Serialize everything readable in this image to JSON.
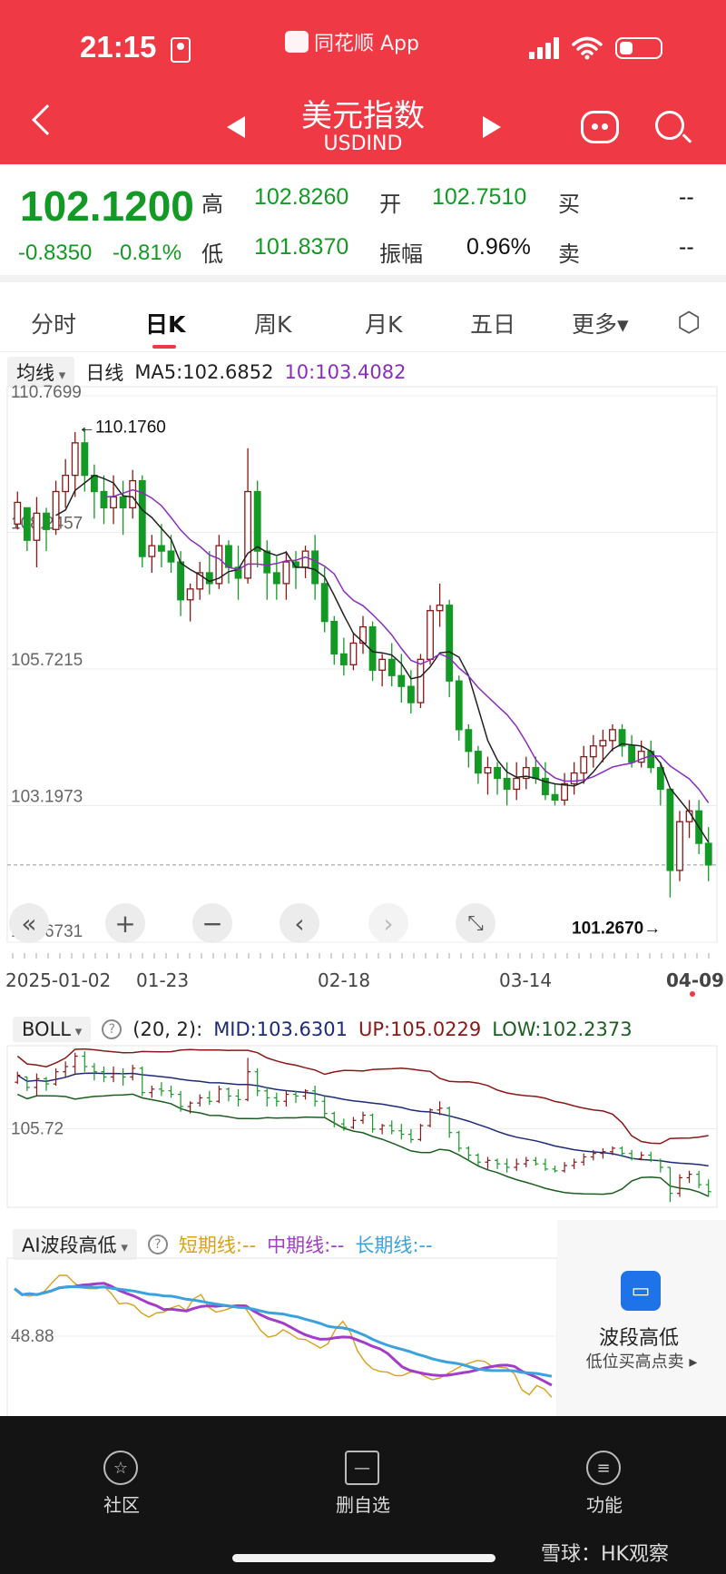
{
  "status_bar": {
    "time": "21:15",
    "app_label": "同花顺 App"
  },
  "header": {
    "title": "美元指数",
    "subtitle": "USDIND"
  },
  "quote": {
    "price": "102.1200",
    "change": "-0.8350",
    "change_pct": "-0.81%",
    "high_label": "高",
    "high": "102.8260",
    "open_label": "开",
    "open": "102.7510",
    "buy_label": "买",
    "buy": "--",
    "low_label": "低",
    "low": "101.8370",
    "amp_label": "振幅",
    "amp": "0.96%",
    "sell_label": "卖",
    "sell": "--"
  },
  "tabs": [
    "分时",
    "日K",
    "周K",
    "月K",
    "五日",
    "更多▾"
  ],
  "active_tab": 1,
  "ma_bar": {
    "selector": "均线",
    "period": "日线",
    "ma5": "MA5:102.6852",
    "ma10": "10:103.4082"
  },
  "main_chart": {
    "y_labels": [
      "110.7699",
      "108.2457",
      "105.7215",
      "103.1973",
      "100.6731"
    ],
    "y_values": [
      110.7699,
      108.2457,
      105.7215,
      103.1973,
      100.6731
    ],
    "max_annot": "←110.1760",
    "min_annot": "101.2670→",
    "x_labels": [
      "2025-01-02",
      "01-23",
      "02-18",
      "03-14",
      "04-09"
    ]
  },
  "controls": [
    "«",
    "+",
    "−",
    "‹",
    "›",
    "⤡"
  ],
  "boll": {
    "selector": "BOLL",
    "params": "(20, 2):",
    "mid": "MID:103.6301",
    "up": "UP:105.0229",
    "low": "LOW:102.2373",
    "y_label": "105.72"
  },
  "ai": {
    "selector": "AI波段高低",
    "short": "短期线:--",
    "mid": "中期线:--",
    "long": "长期线:--",
    "y_label": "48.88"
  },
  "wave_card": {
    "title": "波段高低",
    "subtitle": "低位买高点卖 ▸"
  },
  "colors": {
    "brand_red": "#ef3a45",
    "up": "#8b1717",
    "down": "#139a24",
    "ma10": "#8b2dbd"
  },
  "bottom_nav": [
    {
      "label": "社区",
      "icon": "star-icon"
    },
    {
      "label": "删自选",
      "icon": "minus-icon"
    },
    {
      "label": "功能",
      "icon": "menu-icon"
    }
  ],
  "watermark": "雪球：HK观察",
  "chart_data": {
    "type": "candlestick",
    "x_range": [
      "2025-01-02",
      "2025-04-09"
    ],
    "ylim": [
      100.6731,
      110.7699
    ],
    "series": [
      {
        "name": "日K",
        "values": [
          [
            108.4,
            109.0,
            108.3,
            108.8
          ],
          [
            108.7,
            108.7,
            107.9,
            108.1
          ],
          [
            108.1,
            108.9,
            107.6,
            108.6
          ],
          [
            108.6,
            108.7,
            107.9,
            108.3
          ],
          [
            108.3,
            109.2,
            108.2,
            109.0
          ],
          [
            109.0,
            109.6,
            108.7,
            109.3
          ],
          [
            109.3,
            110.1,
            108.9,
            109.9
          ],
          [
            109.9,
            110.18,
            109.0,
            109.3
          ],
          [
            109.3,
            109.5,
            108.5,
            109.0
          ],
          [
            109.0,
            109.3,
            108.4,
            108.7
          ],
          [
            108.7,
            109.3,
            108.4,
            108.9
          ],
          [
            108.9,
            109.2,
            108.2,
            108.7
          ],
          [
            108.7,
            109.4,
            108.5,
            109.2
          ],
          [
            109.2,
            109.3,
            107.6,
            107.8
          ],
          [
            107.8,
            108.2,
            107.5,
            108.0
          ],
          [
            108.0,
            108.4,
            107.6,
            107.9
          ],
          [
            107.9,
            108.2,
            107.5,
            107.7
          ],
          [
            107.7,
            107.9,
            106.7,
            107.0
          ],
          [
            107.0,
            107.3,
            106.6,
            107.2
          ],
          [
            107.2,
            107.7,
            107.0,
            107.5
          ],
          [
            107.5,
            107.9,
            107.1,
            107.3
          ],
          [
            107.3,
            108.2,
            107.2,
            108.0
          ],
          [
            108.0,
            108.1,
            107.3,
            107.6
          ],
          [
            107.6,
            108.0,
            107.0,
            107.4
          ],
          [
            107.4,
            109.8,
            107.3,
            109.0
          ],
          [
            109.0,
            109.2,
            107.6,
            107.9
          ],
          [
            107.9,
            108.1,
            107.0,
            107.5
          ],
          [
            107.5,
            107.8,
            107.0,
            107.3
          ],
          [
            107.3,
            107.9,
            107.0,
            107.7
          ],
          [
            107.7,
            107.9,
            107.2,
            107.6
          ],
          [
            107.6,
            108.0,
            107.4,
            107.9
          ],
          [
            107.9,
            108.2,
            107.0,
            107.3
          ],
          [
            107.3,
            107.6,
            106.4,
            106.6
          ],
          [
            106.6,
            106.7,
            105.8,
            106.0
          ],
          [
            106.0,
            106.3,
            105.6,
            105.8
          ],
          [
            105.8,
            106.4,
            105.7,
            106.2
          ],
          [
            106.2,
            106.7,
            106.0,
            106.5
          ],
          [
            106.5,
            106.6,
            105.5,
            105.7
          ],
          [
            105.7,
            106.0,
            105.4,
            105.9
          ],
          [
            105.9,
            106.2,
            105.4,
            105.6
          ],
          [
            105.6,
            106.0,
            105.1,
            105.4
          ],
          [
            105.4,
            105.7,
            104.9,
            105.1
          ],
          [
            105.1,
            106.0,
            105.0,
            105.9
          ],
          [
            105.9,
            106.9,
            105.8,
            106.8
          ],
          [
            106.8,
            107.3,
            106.5,
            106.9
          ],
          [
            106.9,
            107.0,
            105.2,
            105.5
          ],
          [
            105.5,
            105.6,
            104.4,
            104.6
          ],
          [
            104.6,
            104.7,
            103.9,
            104.2
          ],
          [
            104.2,
            104.3,
            103.6,
            103.8
          ],
          [
            103.8,
            104.1,
            103.4,
            103.9
          ],
          [
            103.9,
            104.0,
            103.4,
            103.7
          ],
          [
            103.7,
            104.0,
            103.2,
            103.5
          ],
          [
            103.5,
            104.0,
            103.3,
            103.7
          ],
          [
            103.7,
            104.1,
            103.5,
            103.9
          ],
          [
            103.9,
            104.1,
            103.6,
            103.7
          ],
          [
            103.7,
            104.0,
            103.3,
            103.4
          ],
          [
            103.4,
            103.6,
            103.2,
            103.3
          ],
          [
            103.3,
            103.8,
            103.2,
            103.6
          ],
          [
            103.6,
            104.0,
            103.4,
            103.8
          ],
          [
            103.8,
            104.3,
            103.6,
            104.1
          ],
          [
            104.1,
            104.5,
            103.9,
            104.3
          ],
          [
            104.3,
            104.6,
            104.0,
            104.4
          ],
          [
            104.4,
            104.7,
            104.2,
            104.6
          ],
          [
            104.6,
            104.7,
            104.1,
            104.3
          ],
          [
            104.3,
            104.5,
            103.9,
            104.0
          ],
          [
            104.0,
            104.4,
            103.9,
            104.2
          ],
          [
            104.2,
            104.4,
            103.8,
            103.9
          ],
          [
            103.9,
            104.0,
            103.2,
            103.5
          ],
          [
            103.5,
            103.5,
            101.5,
            102.0
          ],
          [
            102.0,
            103.1,
            101.8,
            102.9
          ],
          [
            102.9,
            103.3,
            102.6,
            103.1
          ],
          [
            103.1,
            103.3,
            102.3,
            102.5
          ],
          [
            102.5,
            102.8,
            101.8,
            102.1
          ]
        ]
      }
    ]
  }
}
